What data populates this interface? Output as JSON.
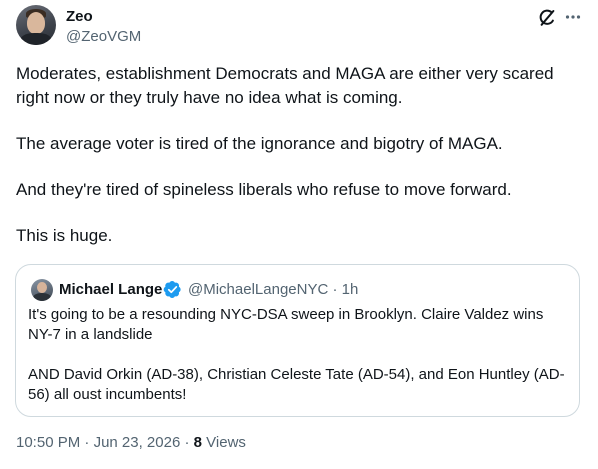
{
  "author": {
    "name": "Zeo",
    "handle": "@ZeoVGM"
  },
  "actions": {
    "grok_icon": "grok-icon",
    "more_icon": "more-icon"
  },
  "tweet": {
    "paragraphs": [
      "Moderates, establishment Democrats and MAGA are either very scared right now or they truly have no idea what is coming.",
      "The average voter is tired of the ignorance and bigotry of MAGA.",
      "And they're tired of spineless liberals who refuse to move forward.",
      "This is huge."
    ]
  },
  "quoted": {
    "name": "Michael Lange",
    "verified_icon": "verified-badge-icon",
    "handle": "@MichaelLangeNYC",
    "separator": "·",
    "time": "1h",
    "paragraphs": [
      "It's going to be a resounding NYC-DSA sweep in Brooklyn. Claire Valdez wins NY-7 in a landslide",
      "AND David Orkin (AD-38), Christian Celeste Tate (AD-54), and Eon Huntley (AD-56) all oust incumbents!"
    ]
  },
  "meta": {
    "time": "10:50 PM",
    "separator": "·",
    "date": "Jun 23, 2026",
    "views_count": "8",
    "views_label": "Views"
  },
  "colors": {
    "text": "#0f1419",
    "secondary": "#536471",
    "border": "#cfd9de",
    "verified": "#1d9bf0"
  }
}
